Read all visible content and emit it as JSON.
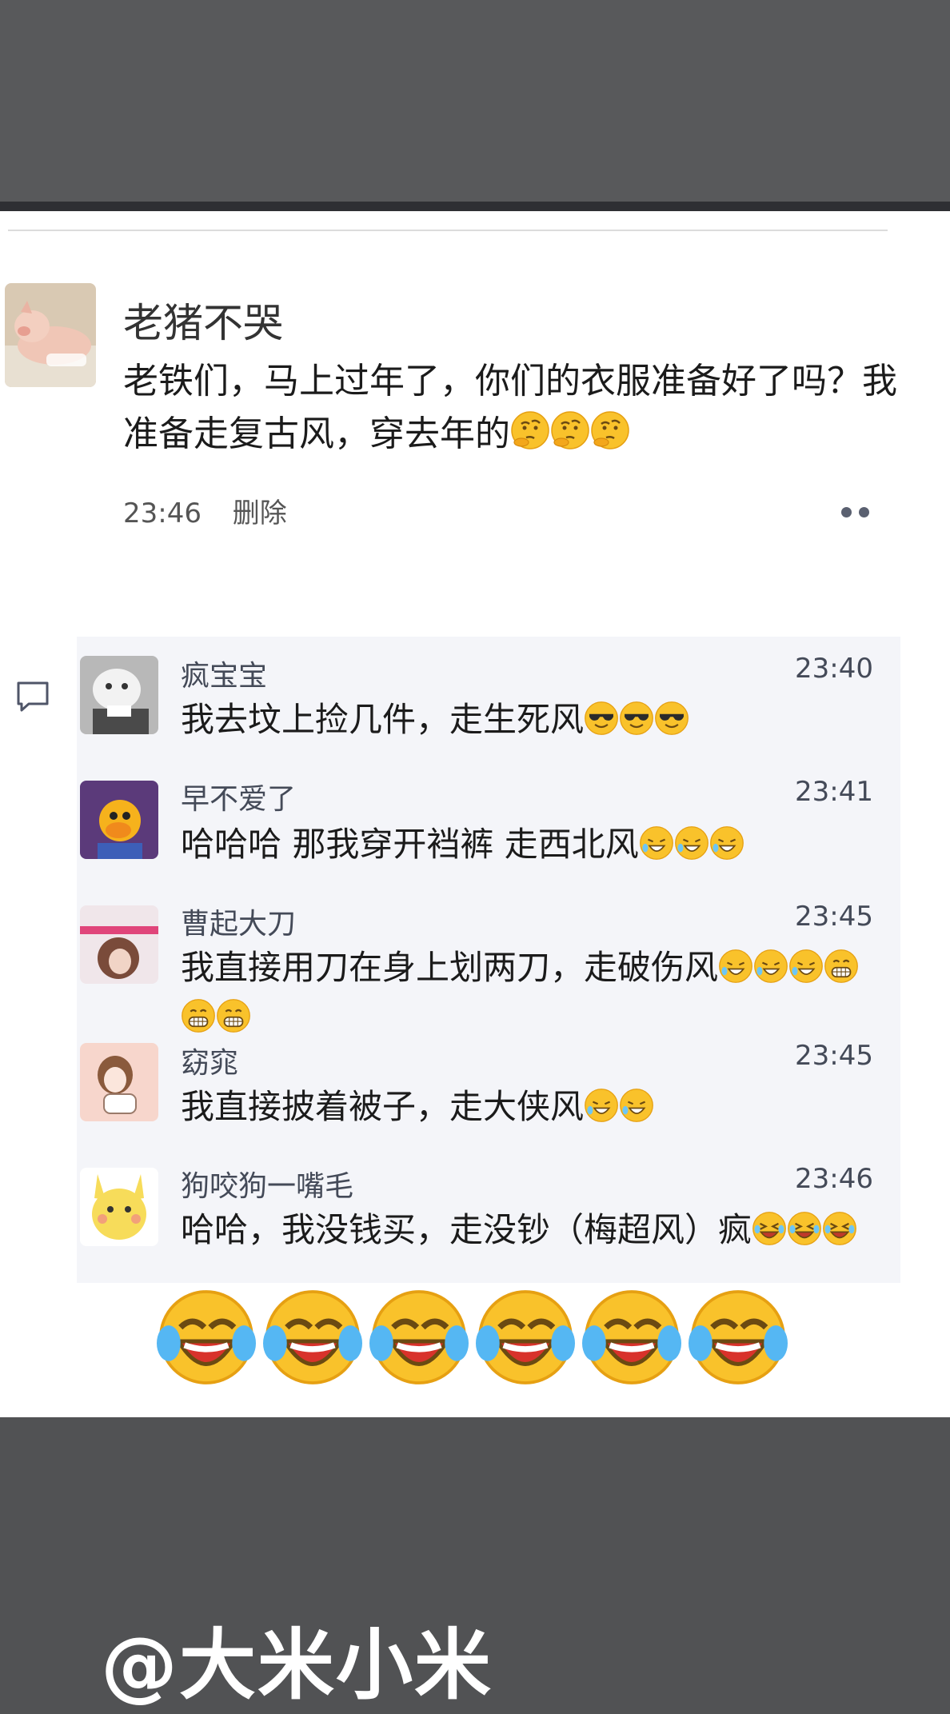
{
  "post": {
    "author": "老猪不哭",
    "text": "老铁们，马上过年了，你们的衣服准备好了吗？我准备走复古风，穿去年的",
    "emoji_icons": [
      "thinking-face-icon",
      "thinking-face-icon",
      "thinking-face-icon"
    ],
    "time": "23:46",
    "delete_label": "删除"
  },
  "comments": [
    {
      "name": "疯宝宝",
      "time": "23:40",
      "text": "我去坟上捡几件，走生死风",
      "emoji_icons": [
        "sunglasses-face-icon",
        "sunglasses-face-icon",
        "sunglasses-face-icon"
      ]
    },
    {
      "name": "早不爱了",
      "time": "23:41",
      "text": "哈哈哈 那我穿开裆裤 走西北风",
      "emoji_icons": [
        "rolling-laugh-icon",
        "rolling-laugh-icon",
        "rolling-laugh-icon"
      ]
    },
    {
      "name": "曹起大刀",
      "time": "23:45",
      "text": "我直接用刀在身上划两刀，走破伤风",
      "emoji_icons": [
        "rolling-laugh-icon",
        "rolling-laugh-icon",
        "rolling-laugh-icon",
        "grinning-face-icon",
        "grinning-face-icon",
        "grinning-face-icon"
      ]
    },
    {
      "name": "窈窕",
      "time": "23:45",
      "text": "我直接披着被子，走大侠风",
      "emoji_icons": [
        "rolling-laugh-icon",
        "rolling-laugh-icon"
      ]
    },
    {
      "name": "狗咬狗一嘴毛",
      "time": "23:46",
      "text": "哈哈，我没钱买，走没钞（梅超风）疯",
      "emoji_icons": [
        "laughing-tears-icon",
        "laughing-tears-icon",
        "laughing-tears-icon"
      ]
    }
  ],
  "reaction_row": [
    "crying-laughing-icon",
    "crying-laughing-icon",
    "crying-laughing-icon",
    "crying-laughing-icon",
    "crying-laughing-icon",
    "crying-laughing-icon"
  ],
  "watermark": "@大米小米",
  "colors": {
    "background": "#515254",
    "card": "#ffffff",
    "comment_box": "#f4f5f9",
    "meta_text": "#444a58"
  }
}
